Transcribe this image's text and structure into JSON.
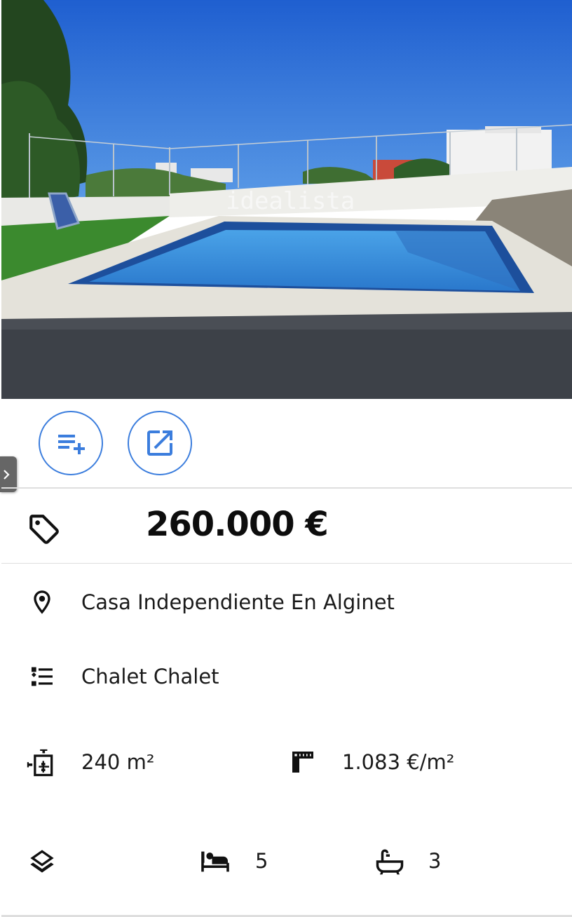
{
  "photo": {
    "alt": "Swimming pool photo",
    "watermark": "idealista"
  },
  "actions": {
    "add_to_list": "add-to-list",
    "open_external": "open-in-new"
  },
  "listing": {
    "price": "260.000 €",
    "location": "Casa Independiente En Alginet",
    "type": "Chalet Chalet",
    "size": "240 m²",
    "price_per_m2": "1.083 €/m²",
    "floor": "",
    "bedrooms": "5",
    "bathrooms": "3"
  },
  "icons": {
    "tag": "tag-icon",
    "location": "map-pin-icon",
    "type": "list-icon",
    "size": "floor-plan-icon",
    "price_per_m2": "ruler-icon",
    "floor": "layers-icon",
    "bedrooms": "bed-icon",
    "bathrooms": "bathtub-icon"
  },
  "colors": {
    "accent": "#3b7ddd",
    "divider": "#dedede",
    "side_tab": "#666666"
  }
}
